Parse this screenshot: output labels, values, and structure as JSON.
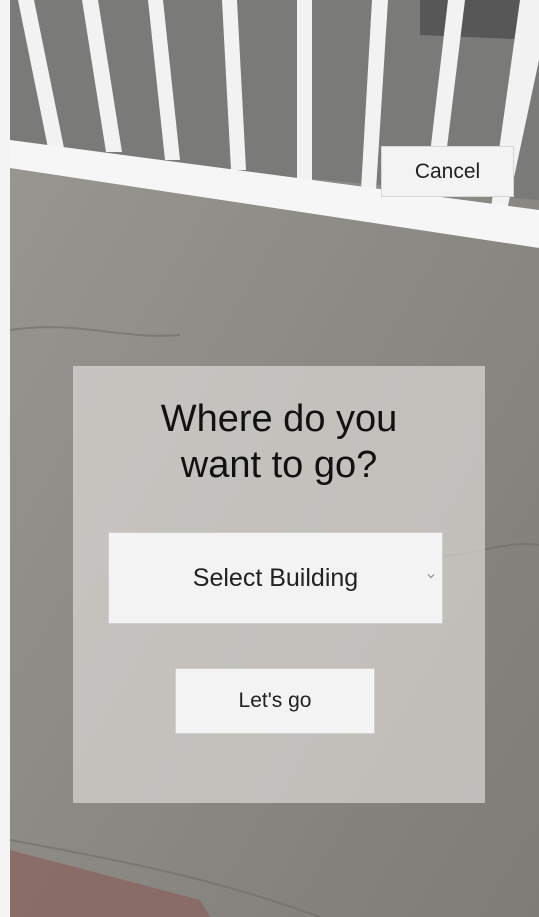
{
  "header": {
    "cancel_label": "Cancel"
  },
  "dialog": {
    "title": "Where do you\nwant to go?",
    "building_select": {
      "selected": "Select Building"
    },
    "go_label": "Let's go"
  },
  "icons": {
    "dropdown": "chevron-down-icon"
  }
}
